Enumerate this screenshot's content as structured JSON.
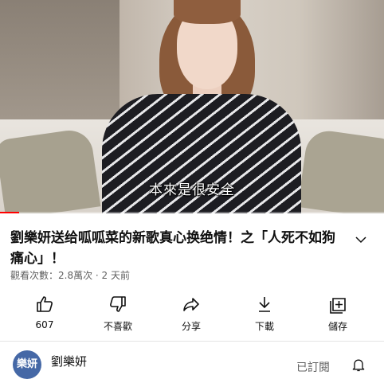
{
  "video": {
    "subtitle": "本來是很安全",
    "progress": 0.05,
    "progress_color": "#ff0000"
  },
  "title": "劉樂妍送给呱呱菜的新歌真心换绝情！之「人死不如狗痛心」！",
  "meta": "觀看次數：2.8萬次 · 2 天前",
  "actions": [
    {
      "icon": "thumbs-up-icon",
      "label": "607"
    },
    {
      "icon": "thumbs-down-icon",
      "label": "不喜歡"
    },
    {
      "icon": "share-icon",
      "label": "分享"
    },
    {
      "icon": "download-icon",
      "label": "下載"
    },
    {
      "icon": "save-playlist-icon",
      "label": "儲存"
    }
  ],
  "channel": {
    "avatar_text": "樂妍",
    "avatar_color": "#4568a6",
    "name": "劉樂妍",
    "subscribe_label": "已訂閱"
  }
}
